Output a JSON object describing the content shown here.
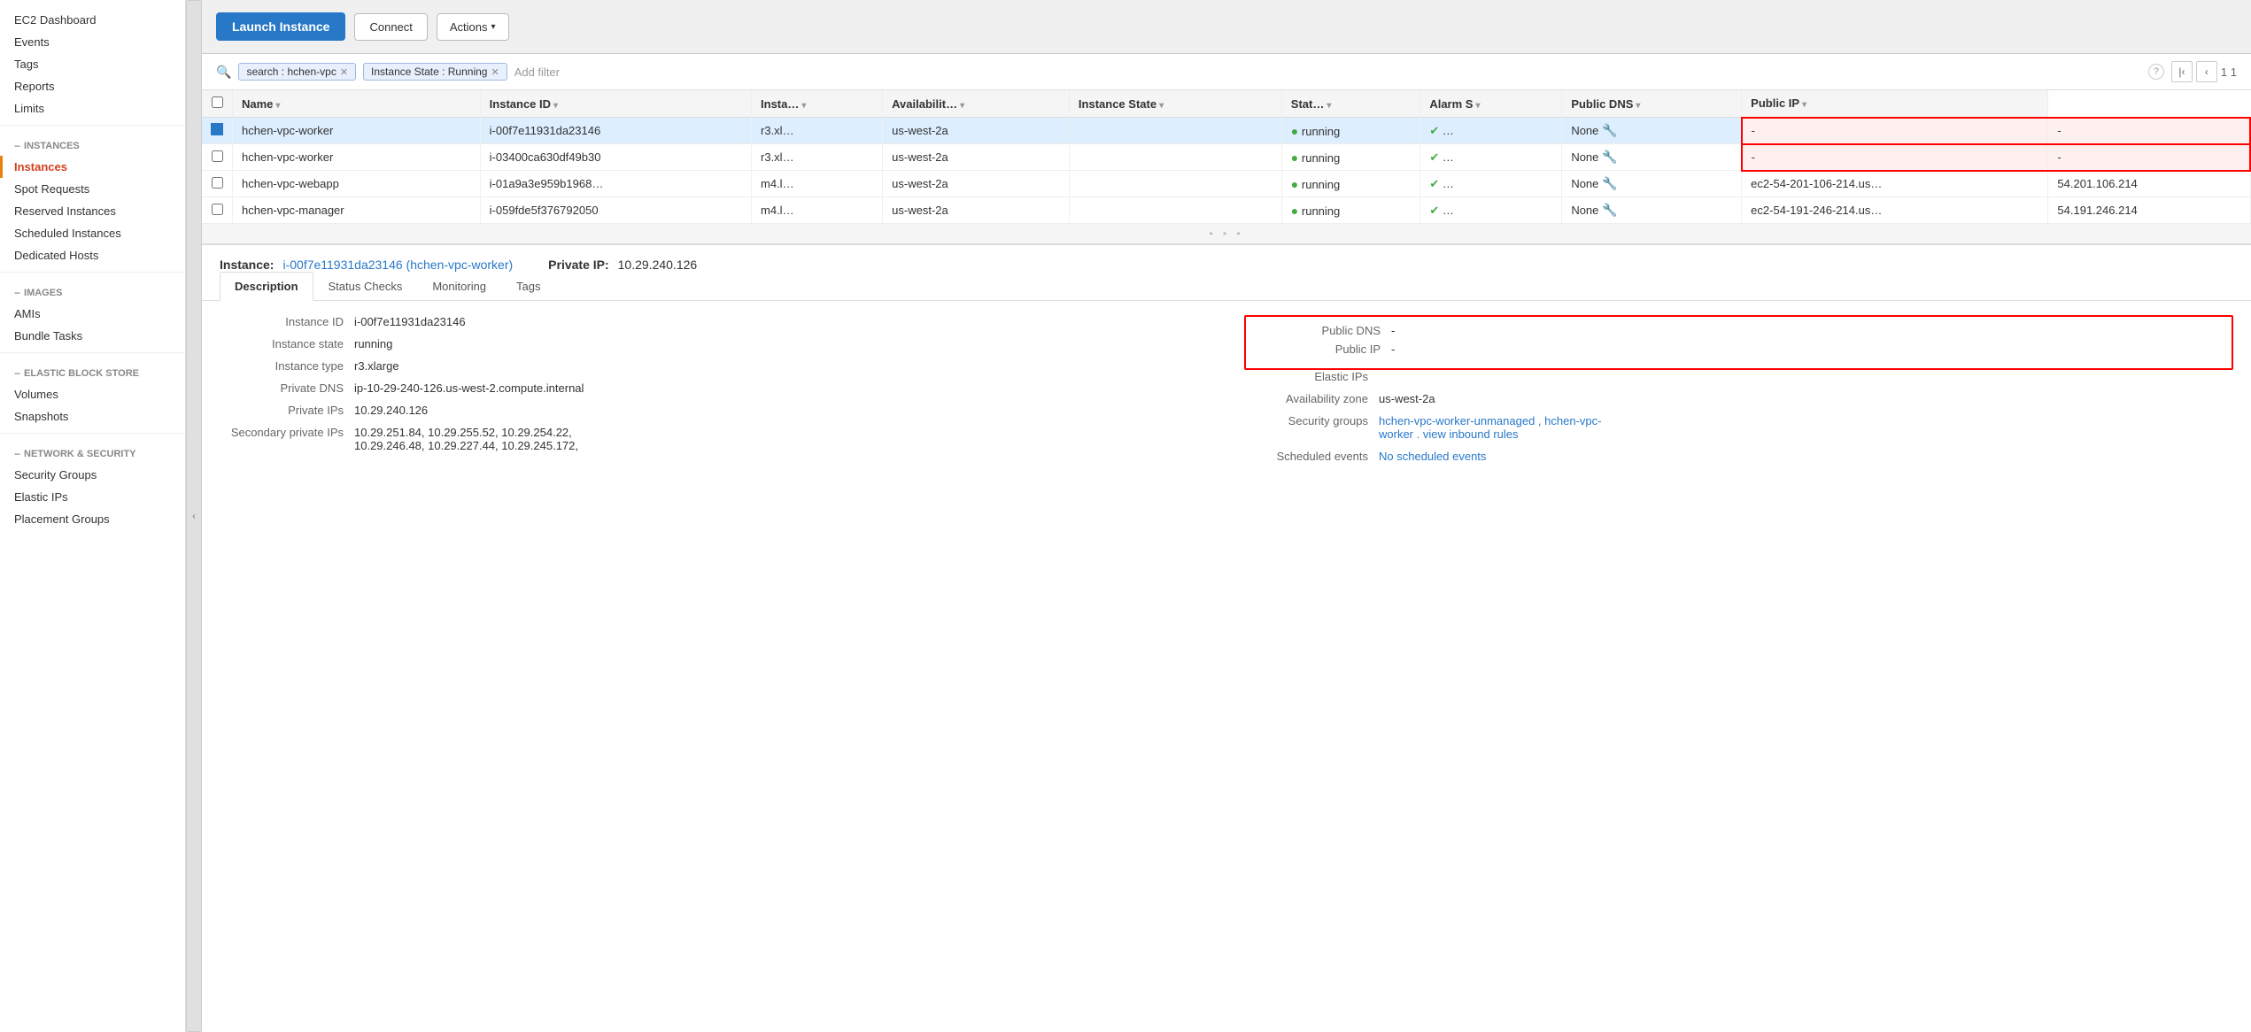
{
  "sidebar": {
    "top_items": [
      {
        "id": "ec2-dashboard",
        "label": "EC2 Dashboard"
      },
      {
        "id": "events",
        "label": "Events"
      },
      {
        "id": "tags",
        "label": "Tags"
      },
      {
        "id": "reports",
        "label": "Reports"
      },
      {
        "id": "limits",
        "label": "Limits"
      }
    ],
    "sections": [
      {
        "id": "instances-section",
        "label": "INSTANCES",
        "items": [
          {
            "id": "instances",
            "label": "Instances",
            "active": true
          },
          {
            "id": "spot-requests",
            "label": "Spot Requests"
          },
          {
            "id": "reserved-instances",
            "label": "Reserved Instances"
          },
          {
            "id": "scheduled-instances",
            "label": "Scheduled Instances"
          },
          {
            "id": "dedicated-hosts",
            "label": "Dedicated Hosts"
          }
        ]
      },
      {
        "id": "images-section",
        "label": "IMAGES",
        "items": [
          {
            "id": "amis",
            "label": "AMIs"
          },
          {
            "id": "bundle-tasks",
            "label": "Bundle Tasks"
          }
        ]
      },
      {
        "id": "ebs-section",
        "label": "ELASTIC BLOCK STORE",
        "items": [
          {
            "id": "volumes",
            "label": "Volumes"
          },
          {
            "id": "snapshots",
            "label": "Snapshots"
          }
        ]
      },
      {
        "id": "network-section",
        "label": "NETWORK & SECURITY",
        "items": [
          {
            "id": "security-groups",
            "label": "Security Groups"
          },
          {
            "id": "elastic-ips",
            "label": "Elastic IPs"
          },
          {
            "id": "placement-groups",
            "label": "Placement Groups"
          }
        ]
      }
    ]
  },
  "toolbar": {
    "launch_label": "Launch Instance",
    "connect_label": "Connect",
    "actions_label": "Actions"
  },
  "filter": {
    "search_tag": "search : hchen-vpc",
    "state_tag": "Instance State : Running",
    "add_filter_placeholder": "Add filter",
    "page_count": "1 1"
  },
  "table": {
    "columns": [
      "",
      "Name",
      "Instance ID",
      "Insta…",
      "Availabilit…",
      "Instance State",
      "Stat…",
      "Alarm S",
      "Public DNS",
      "Public IP"
    ],
    "rows": [
      {
        "selected": true,
        "name": "hchen-vpc-worker",
        "instance_id": "i-00f7e11931da23146",
        "instance_type": "r3.xl…",
        "availability_zone": "us-west-2a",
        "state": "running",
        "status": "✔ …",
        "alarm": "None",
        "public_dns": "-",
        "public_ip": "-",
        "red_highlight": true
      },
      {
        "selected": false,
        "name": "hchen-vpc-worker",
        "instance_id": "i-03400ca630df49b30",
        "instance_type": "r3.xl…",
        "availability_zone": "us-west-2a",
        "state": "running",
        "status": "✔ …",
        "alarm": "None",
        "public_dns": "-",
        "public_ip": "-",
        "red_highlight": true
      },
      {
        "selected": false,
        "name": "hchen-vpc-webapp",
        "instance_id": "i-01a9a3e959b1968…",
        "instance_type": "m4.l…",
        "availability_zone": "us-west-2a",
        "state": "running",
        "status": "✔ …",
        "alarm": "None",
        "public_dns": "ec2-54-201-106-214.us…",
        "public_ip": "54.201.106.214",
        "red_highlight": false
      },
      {
        "selected": false,
        "name": "hchen-vpc-manager",
        "instance_id": "i-059fde5f376792050",
        "instance_type": "m4.l…",
        "availability_zone": "us-west-2a",
        "state": "running",
        "status": "✔ …",
        "alarm": "None",
        "public_dns": "ec2-54-191-246-214.us…",
        "public_ip": "54.191.246.214",
        "red_highlight": false
      }
    ]
  },
  "detail": {
    "instance_label": "Instance:",
    "instance_id": "i-00f7e11931da23146 (hchen-vpc-worker)",
    "private_ip_label": "Private IP:",
    "private_ip": "10.29.240.126",
    "resize_dots": "• • •",
    "tabs": [
      "Description",
      "Status Checks",
      "Monitoring",
      "Tags"
    ],
    "active_tab": "Description",
    "left_col": [
      {
        "label": "Instance ID",
        "value": "i-00f7e11931da23146"
      },
      {
        "label": "Instance state",
        "value": "running"
      },
      {
        "label": "Instance type",
        "value": "r3.xlarge"
      },
      {
        "label": "Private DNS",
        "value": "ip-10-29-240-126.us-west-2.compute.internal"
      },
      {
        "label": "Private IPs",
        "value": "10.29.240.126"
      },
      {
        "label": "Secondary private IPs",
        "value": "10.29.251.84, 10.29.255.52, 10.29.254.22,\n10.29.246.48, 10.29.227.44, 10.29.245.172,"
      }
    ],
    "right_col": [
      {
        "label": "Public DNS",
        "value": "-",
        "red_box": true
      },
      {
        "label": "Public IP",
        "value": "-",
        "red_box": true
      },
      {
        "label": "Elastic IPs",
        "value": ""
      },
      {
        "label": "Availability zone",
        "value": "us-west-2a"
      },
      {
        "label": "Security groups",
        "value": "hchen-vpc-worker-unmanaged ,  hchen-vpc-\nworker .  view inbound rules",
        "is_links": true
      },
      {
        "label": "Scheduled events",
        "value": "No scheduled events",
        "is_blue": true
      }
    ]
  }
}
